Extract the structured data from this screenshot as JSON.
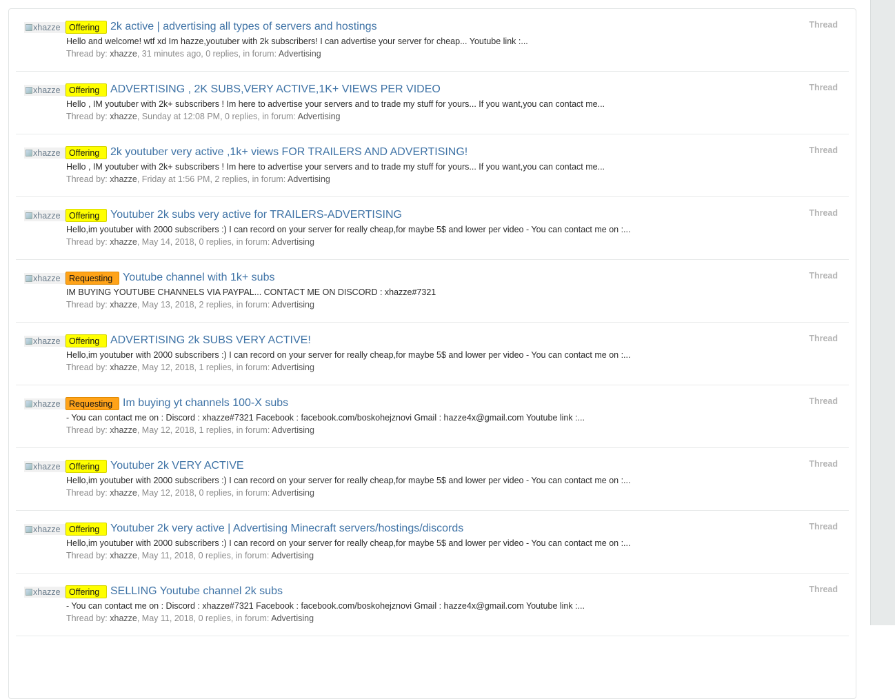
{
  "results": [
    {
      "avatar_alt": "xhazze",
      "prefix": "Offering",
      "title": "2k active | advertising all types of servers and hostings",
      "snippet": "Hello and welcome! wtf xd Im hazze,youtuber with 2k subscribers! I can advertise your server for cheap... Youtube link :...",
      "meta_label": "Thread by:",
      "author": "xhazze",
      "meta_details": ", 31 minutes ago, 0 replies, in forum:",
      "forum": "Advertising",
      "type": "Thread"
    },
    {
      "avatar_alt": "xhazze",
      "prefix": "Offering",
      "title": "ADVERTISING , 2K SUBS,VERY ACTIVE,1K+ VIEWS PER VIDEO",
      "snippet": "Hello , IM youtuber with 2k+ subscribers ! Im here to advertise your servers and to trade my stuff for yours... If you want,you can contact me...",
      "meta_label": "Thread by:",
      "author": "xhazze",
      "meta_details": ", Sunday at 12:08 PM, 0 replies, in forum:",
      "forum": "Advertising",
      "type": "Thread"
    },
    {
      "avatar_alt": "xhazze",
      "prefix": "Offering",
      "title": "2k youtuber very active ,1k+ views FOR TRAILERS AND ADVERTISING!",
      "snippet": "Hello , IM youtuber with 2k+ subscribers ! Im here to advertise your servers and to trade my stuff for yours... If you want,you can contact me...",
      "meta_label": "Thread by:",
      "author": "xhazze",
      "meta_details": ", Friday at 1:56 PM, 2 replies, in forum:",
      "forum": "Advertising",
      "type": "Thread"
    },
    {
      "avatar_alt": "xhazze",
      "prefix": "Offering",
      "title": "Youtuber 2k subs very active for TRAILERS-ADVERTISING",
      "snippet": "Hello,im youtuber with 2000 subscribers :) I can record on your server for really cheap,for maybe 5$ and lower per video - You can contact me on :...",
      "meta_label": "Thread by:",
      "author": "xhazze",
      "meta_details": ", May 14, 2018, 0 replies, in forum:",
      "forum": "Advertising",
      "type": "Thread"
    },
    {
      "avatar_alt": "xhazze",
      "prefix": "Requesting",
      "title": "Youtube channel with 1k+ subs",
      "snippet": "IM BUYING YOUTUBE CHANNELS VIA PAYPAL... CONTACT ME ON DISCORD : xhazze#7321",
      "meta_label": "Thread by:",
      "author": "xhazze",
      "meta_details": ", May 13, 2018, 2 replies, in forum:",
      "forum": "Advertising",
      "type": "Thread"
    },
    {
      "avatar_alt": "xhazze",
      "prefix": "Offering",
      "title": "ADVERTISING 2k SUBS VERY ACTIVE!",
      "snippet": "Hello,im youtuber with 2000 subscribers :) I can record on your server for really cheap,for maybe 5$ and lower per video - You can contact me on :...",
      "meta_label": "Thread by:",
      "author": "xhazze",
      "meta_details": ", May 12, 2018, 1 replies, in forum:",
      "forum": "Advertising",
      "type": "Thread"
    },
    {
      "avatar_alt": "xhazze",
      "prefix": "Requesting",
      "title": "Im buying yt channels 100-X subs",
      "snippet": "- You can contact me on : Discord : xhazze#7321 Facebook : facebook.com/boskohejznovi Gmail : hazze4x@gmail.com Youtube link :...",
      "meta_label": "Thread by:",
      "author": "xhazze",
      "meta_details": ", May 12, 2018, 1 replies, in forum:",
      "forum": "Advertising",
      "type": "Thread"
    },
    {
      "avatar_alt": "xhazze",
      "prefix": "Offering",
      "title": "Youtuber 2k VERY ACTIVE",
      "snippet": "Hello,im youtuber with 2000 subscribers :) I can record on your server for really cheap,for maybe 5$ and lower per video - You can contact me on :...",
      "meta_label": "Thread by:",
      "author": "xhazze",
      "meta_details": ", May 12, 2018, 0 replies, in forum:",
      "forum": "Advertising",
      "type": "Thread"
    },
    {
      "avatar_alt": "xhazze",
      "prefix": "Offering",
      "title": "Youtuber 2k very active | Advertising Minecraft servers/hostings/discords",
      "snippet": "Hello,im youtuber with 2000 subscribers :) I can record on your server for really cheap,for maybe 5$ and lower per video - You can contact me on :...",
      "meta_label": "Thread by:",
      "author": "xhazze",
      "meta_details": ", May 11, 2018, 0 replies, in forum:",
      "forum": "Advertising",
      "type": "Thread"
    },
    {
      "avatar_alt": "xhazze",
      "prefix": "Offering",
      "title": "SELLING Youtube channel 2k subs",
      "snippet": "- You can contact me on : Discord : xhazze#7321 Facebook : facebook.com/boskohejznovi Gmail : hazze4x@gmail.com Youtube link :...",
      "meta_label": "Thread by:",
      "author": "xhazze",
      "meta_details": ", May 11, 2018, 0 replies, in forum:",
      "forum": "Advertising",
      "type": "Thread"
    }
  ],
  "colors": {
    "offering": "#ffff00",
    "requesting": "#ffa319",
    "title_link": "#3f73a6"
  }
}
